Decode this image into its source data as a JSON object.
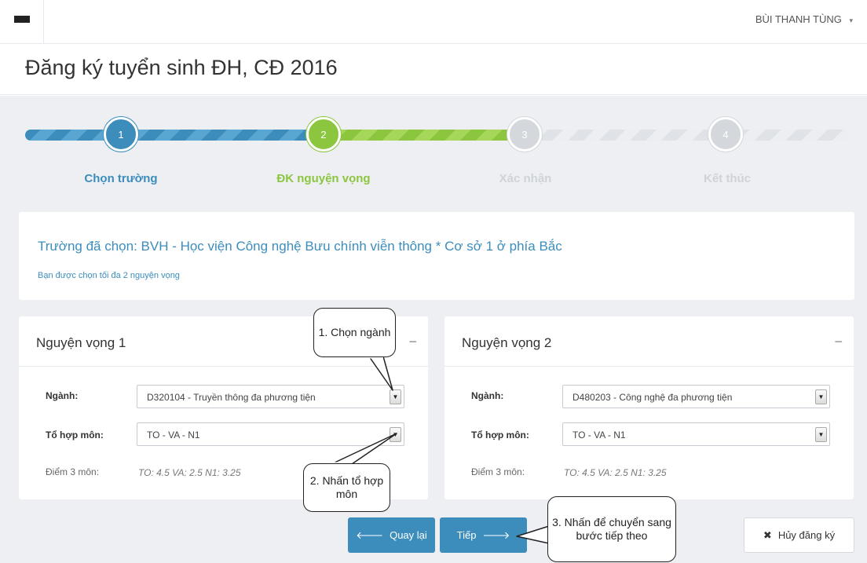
{
  "header": {
    "user_name": "BÙI THANH TÙNG",
    "caret": "▾"
  },
  "page": {
    "title": "Đăng ký tuyển sinh ĐH, CĐ 2016"
  },
  "stepper": {
    "steps": [
      {
        "number": "1",
        "label": "Chọn trường",
        "state": "done"
      },
      {
        "number": "2",
        "label": "ĐK nguyện vọng",
        "state": "active"
      },
      {
        "number": "3",
        "label": "Xác nhận",
        "state": "pending"
      },
      {
        "number": "4",
        "label": "Kết thúc",
        "state": "pending"
      }
    ],
    "colors": {
      "done": "#3c8dbc",
      "active": "#8cc63f",
      "pending": "#d4d7db"
    }
  },
  "info": {
    "school": "Trường đã chọn: BVH - Học viện Công nghệ Bưu chính viễn thông * Cơ sở 1 ở phía Bắc",
    "note": "Bạn được chọn tối đa 2 nguyện vọng"
  },
  "choices": [
    {
      "title": "Nguyện vọng 1",
      "collapse": "−",
      "major_label": "Ngành:",
      "major_value": "D320104 - Truyền thông đa phương tiện",
      "combo_label": "Tổ hợp môn:",
      "combo_value": "TO - VA - N1",
      "score_label": "Điểm 3 môn:",
      "score_value": "TO: 4.5 VA: 2.5 N1: 3.25"
    },
    {
      "title": "Nguyện vọng 2",
      "collapse": "−",
      "major_label": "Ngành:",
      "major_value": "D480203 - Công nghệ đa phương tiện",
      "combo_label": "Tổ hợp môn:",
      "combo_value": "TO - VA - N1",
      "score_label": "Điểm 3 môn:",
      "score_value": "TO: 4.5 VA: 2.5 N1: 3.25"
    }
  ],
  "actions": {
    "back_label": "Quay lại",
    "next_label": "Tiếp",
    "cancel_label": "Hủy đăng ký"
  },
  "annotations": {
    "step1": "1. Chọn ngành",
    "step2": "2. Nhấn tổ hợp môn",
    "step3": "3. Nhấn để chuyển sang bước tiếp theo"
  },
  "icons": {
    "menu": "hamburger-icon",
    "back": "arrow-left-icon",
    "next": "arrow-right-icon",
    "cancel": "close-icon",
    "dropdown": "chevron-down-icon"
  }
}
